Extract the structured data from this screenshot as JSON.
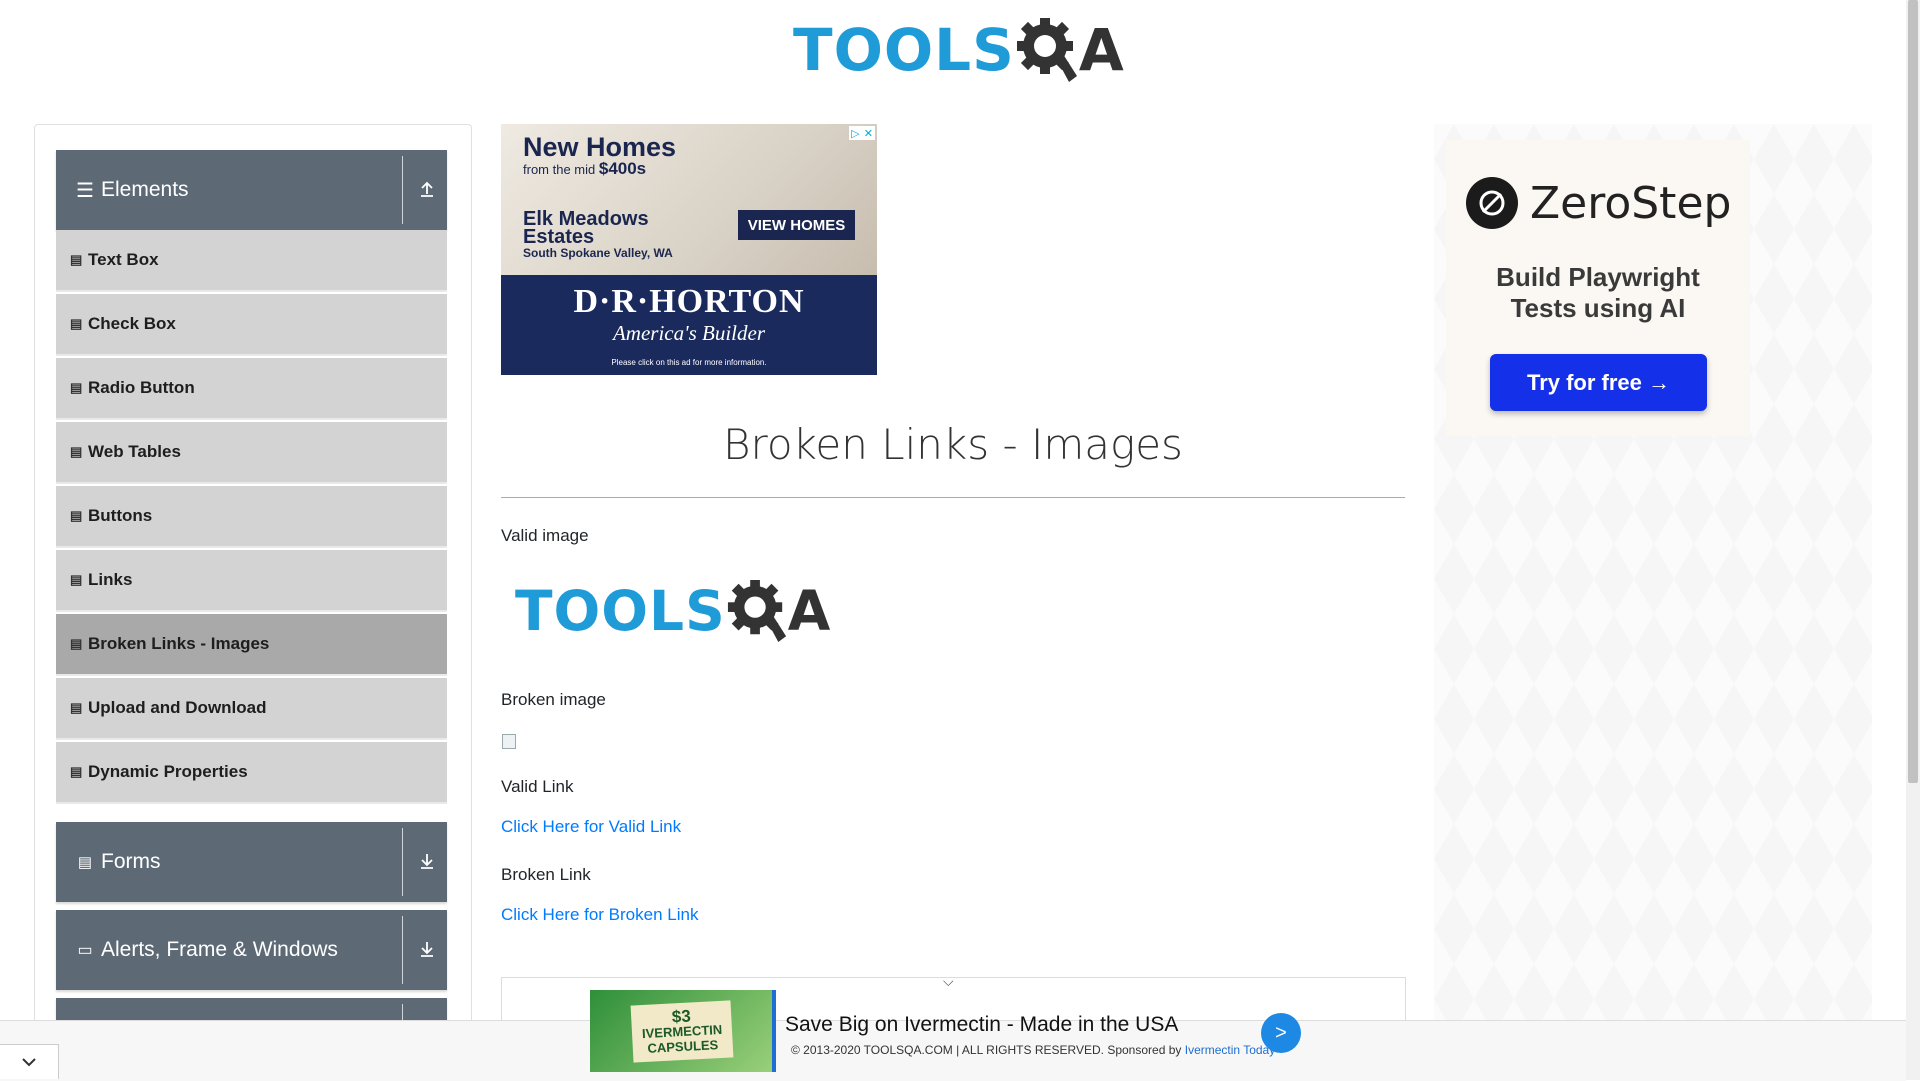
{
  "header": {
    "logo_tools": "TOOLS",
    "logo_qa": "QA"
  },
  "sidebar": {
    "groups": [
      {
        "label": "Elements",
        "icon": "hamburger-icon",
        "expanded": true
      },
      {
        "label": "Forms",
        "icon": "form-icon",
        "expanded": false
      },
      {
        "label": "Alerts, Frame & Windows",
        "icon": "window-icon",
        "expanded": false
      }
    ],
    "items": [
      {
        "label": "Text Box"
      },
      {
        "label": "Check Box"
      },
      {
        "label": "Radio Button"
      },
      {
        "label": "Web Tables"
      },
      {
        "label": "Buttons"
      },
      {
        "label": "Links"
      },
      {
        "label": "Broken Links - Images",
        "active": true
      },
      {
        "label": "Upload and Download"
      },
      {
        "label": "Dynamic Properties"
      }
    ]
  },
  "top_ad": {
    "headline": "New Homes",
    "subhead_prefix": "from the mid ",
    "price": "$400s",
    "estates_line1": "Elk Meadows",
    "estates_line2": "Estates",
    "location": "South Spokane Valley, WA",
    "button": "VIEW HOMES",
    "brand": "D·R·HORTON",
    "tagline": "America's Builder",
    "fine_print": "Please click on this ad for more information."
  },
  "main": {
    "title": "Broken Links - Images",
    "valid_image_label": "Valid image",
    "broken_image_label": "Broken image",
    "valid_link_label": "Valid Link",
    "valid_link_text": "Click Here for Valid Link",
    "broken_link_label": "Broken Link",
    "broken_link_text": "Click Here for Broken Link"
  },
  "right_ad": {
    "brand": "ZeroStep",
    "tagline_line1": "Build Playwright",
    "tagline_line2": "Tests using AI",
    "button": "Try for free →"
  },
  "bottom_ad": {
    "thumb_price": "$3",
    "thumb_line1": "IVERMECTIN",
    "thumb_line2": "CAPSULES",
    "headline": "Save Big on Ivermectin - Made in the USA",
    "footer_copy": "© 2013-2020 TOOLSQA.COM | ALL RIGHTS RESERVED.",
    "sponsored": "Sponsored by",
    "sponsor_link": "Ivermectin Today",
    "go": ">"
  }
}
